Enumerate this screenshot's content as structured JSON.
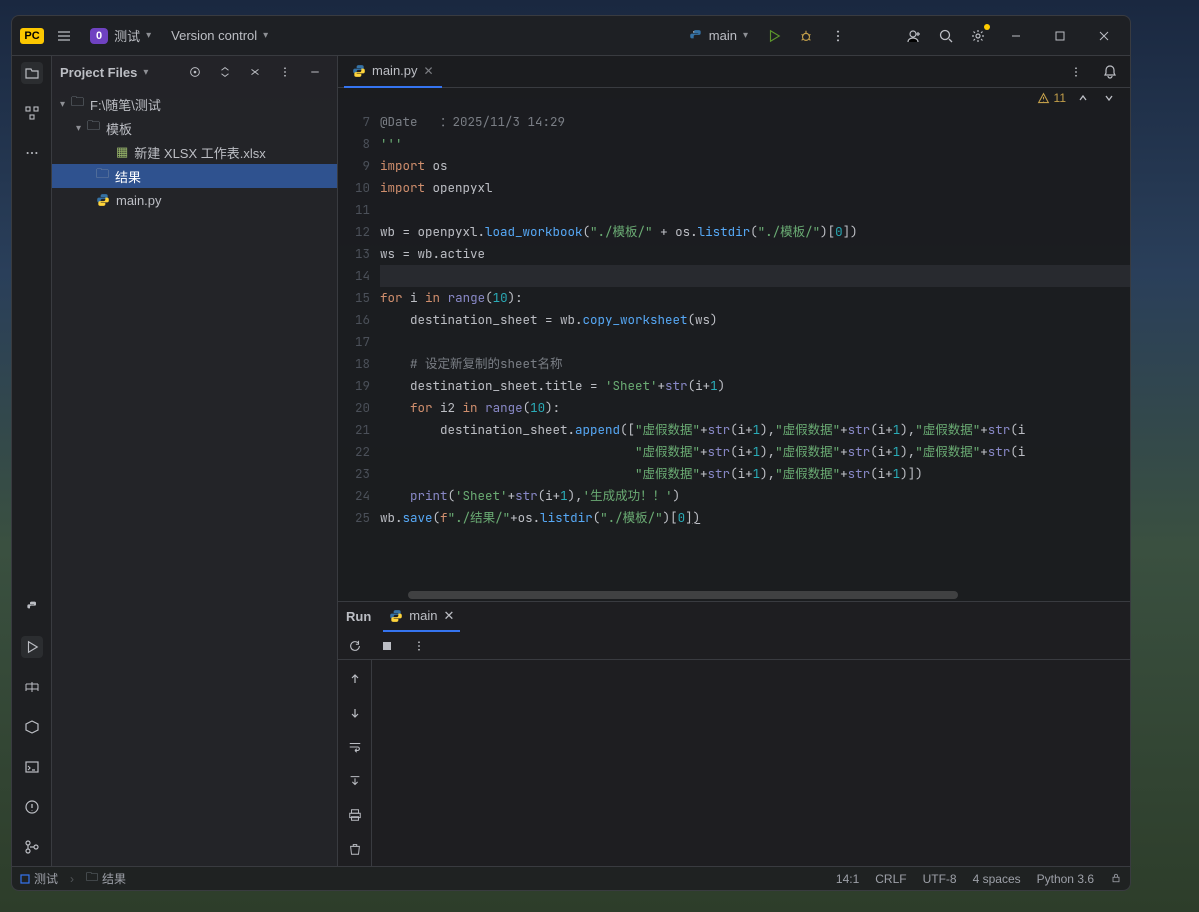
{
  "topbar": {
    "project_badge": "0",
    "project_name": "测试",
    "version_control": "Version control",
    "run_config": "main"
  },
  "project_panel": {
    "title": "Project Files",
    "root": "F:\\随笔\\测试",
    "folder_templates": "模板",
    "file_xlsx": "新建 XLSX 工作表.xlsx",
    "folder_results": "结果",
    "file_main": "main.py"
  },
  "editor": {
    "tab_name": "main.py",
    "warnings": "11",
    "line_start": 7,
    "lines": [
      {
        "html": "<span class='cm'>@Date   ：2025/11/3 14:29</span>"
      },
      {
        "html": "<span class='str'>'''</span>"
      },
      {
        "html": "<span class='kw'>import</span> os"
      },
      {
        "html": "<span class='kw'>import</span> openpyxl"
      },
      {
        "html": ""
      },
      {
        "html": "wb = openpyxl.<span class='fn'>load_workbook</span>(<span class='str'>\"./模板/\"</span> + os.<span class='fn'>listdir</span>(<span class='str'>\"./模板/\"</span>)[<span class='num'>0</span>])"
      },
      {
        "html": "ws = wb.active"
      },
      {
        "html": "",
        "current": true
      },
      {
        "html": "<span class='kw'>for</span> i <span class='kw'>in</span> <span class='builtin'>range</span>(<span class='num'>10</span>):"
      },
      {
        "html": "    destination_sheet = wb.<span class='fn'>copy_worksheet</span>(ws)"
      },
      {
        "html": ""
      },
      {
        "html": "    <span class='cm'># 设定新复制的sheet名称</span>"
      },
      {
        "html": "    destination_sheet.title = <span class='str'>'Sheet'</span>+<span class='builtin'>str</span>(i+<span class='num'>1</span>)"
      },
      {
        "html": "    <span class='kw'>for</span> i2 <span class='kw'>in</span> <span class='builtin'>range</span>(<span class='num'>10</span>):"
      },
      {
        "html": "        destination_sheet.<span class='fn'>append</span>([<span class='str'>\"虚假数据\"</span>+<span class='builtin'>str</span>(i+<span class='num'>1</span>),<span class='str'>\"虚假数据\"</span>+<span class='builtin'>str</span>(i+<span class='num'>1</span>),<span class='str'>\"虚假数据\"</span>+<span class='builtin'>str</span>(i"
      },
      {
        "html": "                                  <span class='str'>\"虚假数据\"</span>+<span class='builtin'>str</span>(i+<span class='num'>1</span>),<span class='str'>\"虚假数据\"</span>+<span class='builtin'>str</span>(i+<span class='num'>1</span>),<span class='str'>\"虚假数据\"</span>+<span class='builtin'>str</span>(i"
      },
      {
        "html": "                                  <span class='str'>\"虚假数据\"</span>+<span class='builtin'>str</span>(i+<span class='num'>1</span>),<span class='str'>\"虚假数据\"</span>+<span class='builtin'>str</span>(i+<span class='num'>1</span>)])"
      },
      {
        "html": "    <span class='builtin'>print</span>(<span class='str'>'Sheet'</span>+<span class='builtin'>str</span>(i+<span class='num'>1</span>),<span class='str'>'生成成功！！'</span>)"
      },
      {
        "html": "wb.<span class='fn'>save</span>(<span class='kw'>f</span><span class='str'>\"./结果/\"</span>+os.<span class='fn'>listdir</span>(<span class='str'>\"./模板/\"</span>)[<span class='num'>0</span>]<u>)</u>"
      }
    ]
  },
  "run": {
    "title": "Run",
    "tab": "main"
  },
  "status": {
    "breadcrumb1": "测试",
    "breadcrumb2": "结果",
    "cursor": "14:1",
    "line_ending": "CRLF",
    "encoding": "UTF-8",
    "indent": "4 spaces",
    "interpreter": "Python 3.6"
  }
}
